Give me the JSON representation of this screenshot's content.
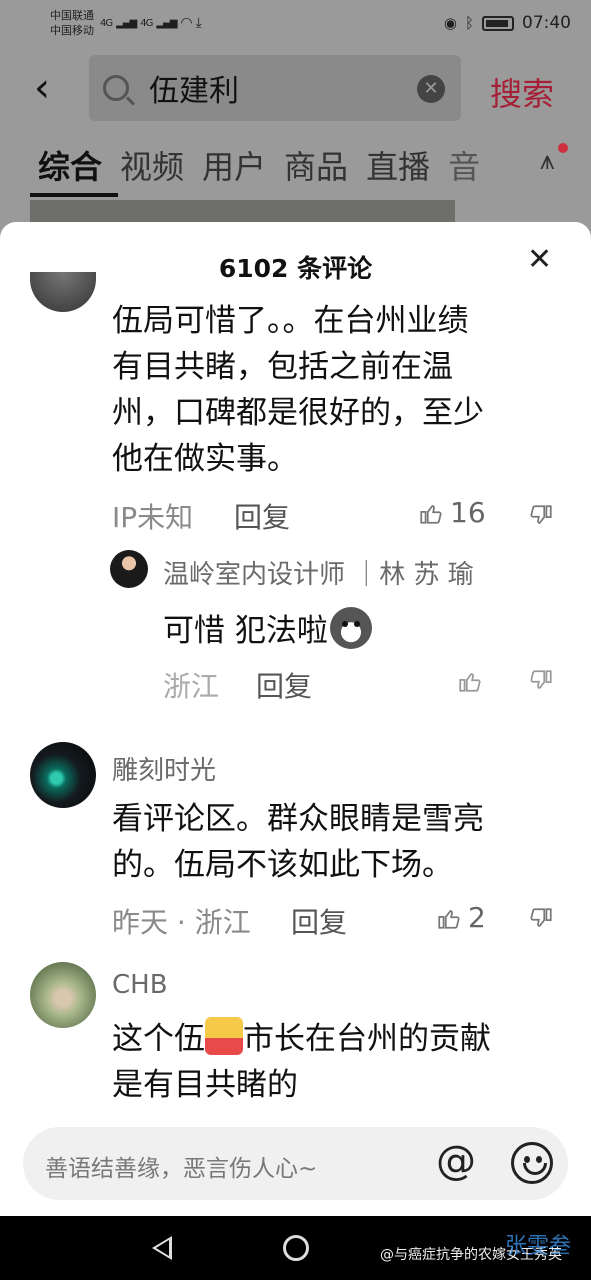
{
  "status_bar": {
    "carrier1": "中国联通",
    "carrier2": "中国移动",
    "signal1": "4G",
    "signal2": "4G",
    "time": "07:40"
  },
  "search": {
    "query": "伍建利",
    "button_label": "搜索"
  },
  "tabs": [
    "综合",
    "视频",
    "用户",
    "商品",
    "直播",
    "音"
  ],
  "comments_sheet": {
    "title": "6102 条评论",
    "comments": [
      {
        "text_lines": [
          "伍局可惜了。。在台州业绩",
          "有目共睹，包括之前在温",
          "州，口碑都是很好的，至少",
          "他在做实事。"
        ],
        "meta": "IP未知",
        "reply_label": "回复",
        "likes": "16"
      },
      {
        "username": "雕刻时光",
        "text_lines": [
          "看评论区。群众眼睛是雪亮",
          "的。伍局不该如此下场。"
        ],
        "meta": "昨天 · 浙江",
        "reply_label": "回复",
        "likes": "2"
      },
      {
        "username": "CHB",
        "text_before": "这个伍",
        "text_after": "市长在台州的贡献",
        "text_line2": "是有目共睹的"
      }
    ],
    "reply": {
      "username": "温岭室内设计师 ｜林 苏 瑜",
      "text": "可惜 犯法啦",
      "meta": "浙江",
      "reply_label": "回复"
    }
  },
  "input": {
    "placeholder": "善语结善缘，恶言伤人心~",
    "at_symbol": "@"
  },
  "watermark": {
    "text": "@与癌症抗争的农嫁女王秀英",
    "logo_text": "张雯叁"
  }
}
